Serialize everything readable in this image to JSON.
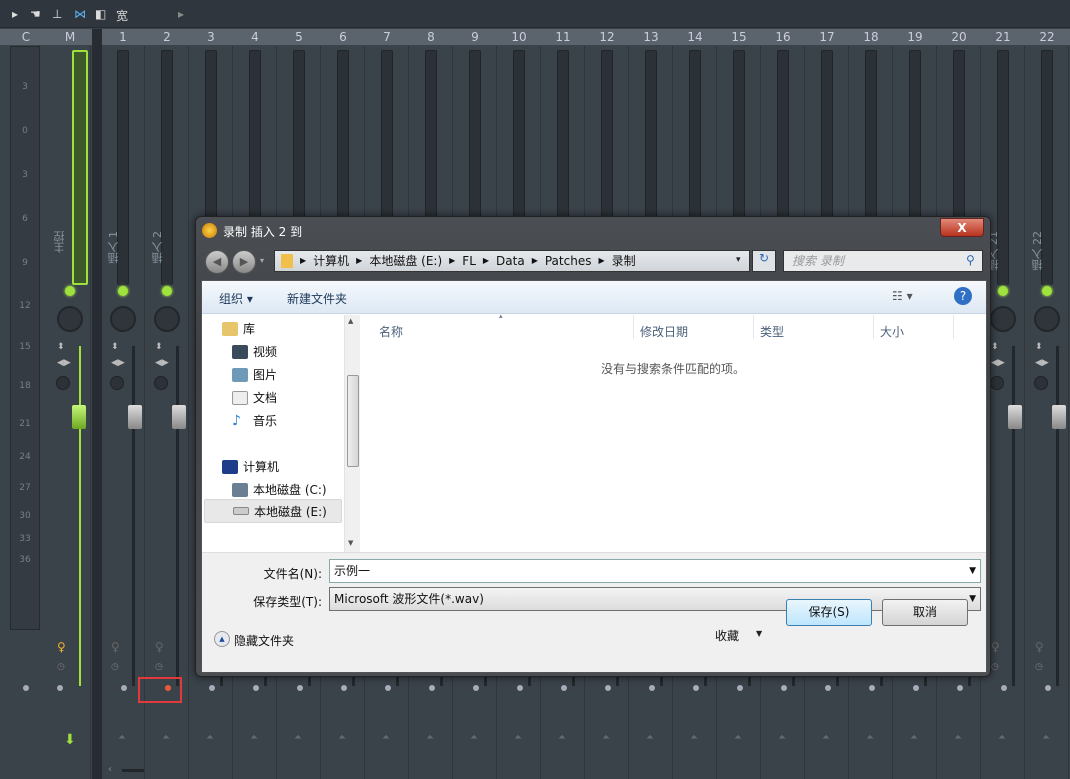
{
  "mixer": {
    "toolbar_label": "宽",
    "col_c": "C",
    "col_m": "M",
    "master_label": "主控",
    "scale": [
      "3",
      "0",
      "3",
      "6",
      "9",
      "12",
      "15",
      "18",
      "21",
      "24",
      "27",
      "30",
      "33",
      "36"
    ],
    "strips": [
      "1",
      "2",
      "3",
      "4",
      "5",
      "6",
      "7",
      "8",
      "9",
      "10",
      "11",
      "12",
      "13",
      "14",
      "15",
      "16",
      "17",
      "18",
      "19",
      "20",
      "21",
      "22"
    ],
    "insert_prefix": "插入 ",
    "armed_strip": "2",
    "accent_color": "#9fe23c",
    "armed_color": "#e85a3a"
  },
  "dialog": {
    "title": "录制 插入 2 到",
    "close": "X",
    "breadcrumb": [
      "计算机",
      "本地磁盘 (E:)",
      "FL",
      "Data",
      "Patches",
      "录制"
    ],
    "search_placeholder": "搜索 录制",
    "toolbar": {
      "organize": "组织 ▾",
      "new_folder": "新建文件夹"
    },
    "nav": {
      "library": "库",
      "items": [
        "视频",
        "图片",
        "文档",
        "音乐"
      ],
      "computer": "计算机",
      "drives": [
        "本地磁盘 (C:)",
        "本地磁盘 (E:)"
      ]
    },
    "columns": [
      "名称",
      "修改日期",
      "类型",
      "大小"
    ],
    "empty_message": "没有与搜索条件匹配的项。",
    "filename_label": "文件名(N):",
    "filename_value": "示例一",
    "filetype_label": "保存类型(T):",
    "filetype_value": "Microsoft 波形文件(*.wav)",
    "hide_folders": "隐藏文件夹",
    "favorites": "收藏",
    "save": "保存(S)",
    "cancel": "取消"
  }
}
